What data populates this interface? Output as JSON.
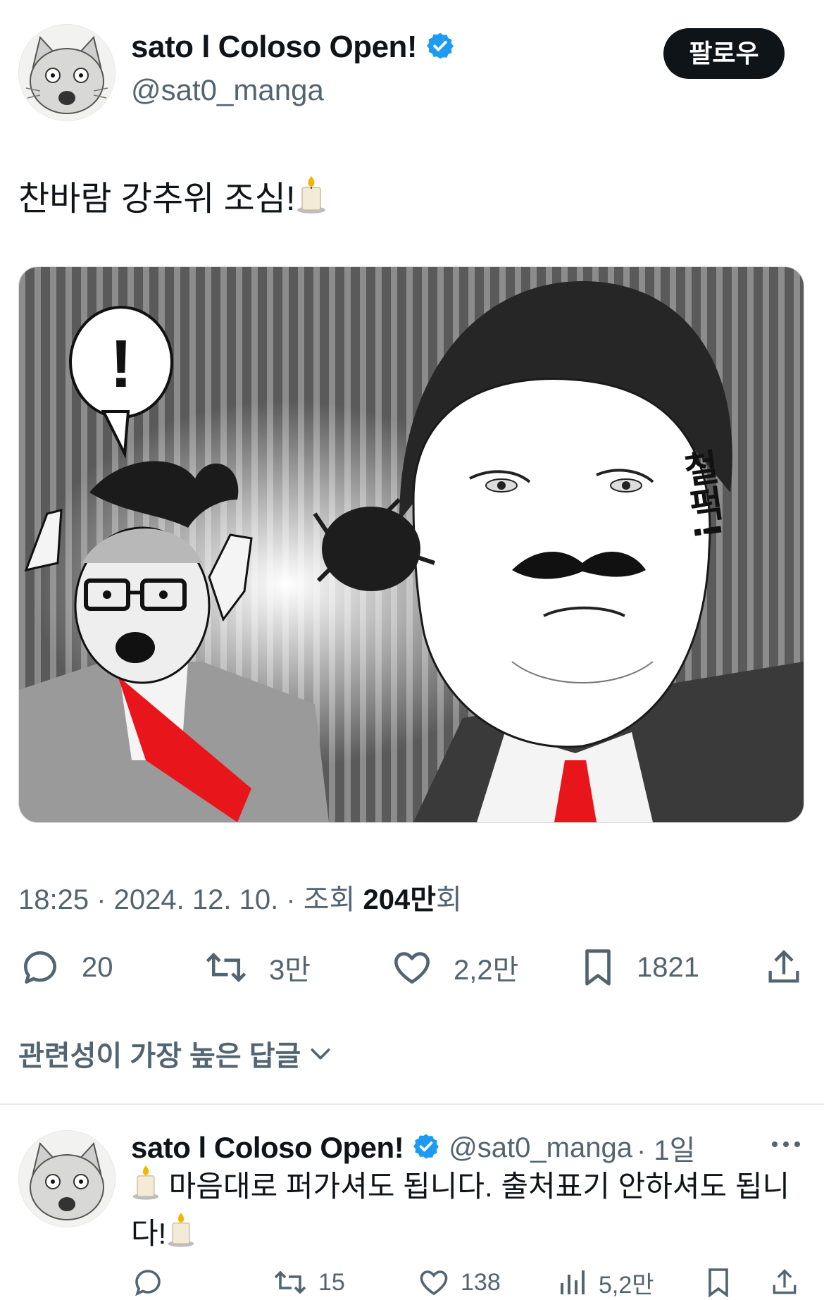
{
  "author": {
    "name": "sato l Coloso Open!",
    "handle": "@sat0_manga",
    "follow_label": "팔로우"
  },
  "tweet": {
    "text": "찬바람 강추위 조심!",
    "emoji": "candle-icon",
    "comic": {
      "speech_bubble": "!",
      "sfx": "철퍽!"
    },
    "time": "18:25 · 2024. 12. 10. · 조회 ",
    "views": "204만",
    "views_suffix": "회"
  },
  "actions": {
    "replies": "20",
    "retweets": "3만",
    "likes": "2,2만",
    "bookmarks": "1821"
  },
  "replies_sort": {
    "label": "관련성이 가장 높은 답글"
  },
  "reply": {
    "name": "sato l Coloso Open!",
    "handle": "@sat0_manga",
    "time": "· 1일",
    "text_line1": "마음대로 퍼가셔도 됩니다. 출처표기 안하셔도 됩니",
    "text_line2": "다!",
    "actions": {
      "replies": "",
      "retweets": "15",
      "likes": "138",
      "views": "5,2만",
      "bookmarks": ""
    }
  },
  "colors": {
    "accent": "#1d9bf0",
    "muted": "#536471",
    "text": "#0f1419",
    "tie_red": "#e8161b"
  }
}
